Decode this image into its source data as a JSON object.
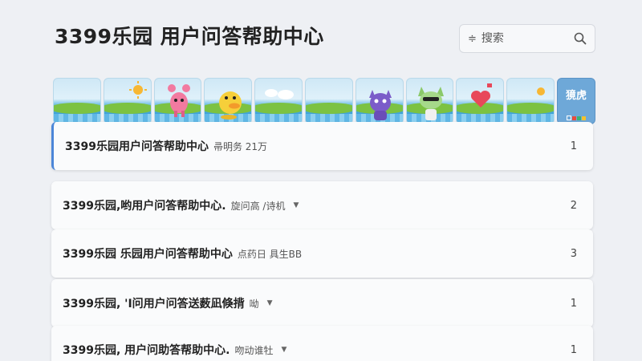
{
  "header": {
    "title": "3399乐园 用户问答帮助中心",
    "search_placeholder": "搜索"
  },
  "banner": {
    "tile_icons": [
      "landscape",
      "sun-icon",
      "pink-creature-icon",
      "yellow-duck-icon",
      "clouds-icon",
      "landscape",
      "purple-cat-icon",
      "green-cat-icon",
      "heart-icon",
      "sun-icon"
    ],
    "label": "獍虎"
  },
  "rows": [
    {
      "title": "3399乐园用户问答帮助中心",
      "meta": "帚明务 21万",
      "has_caret": false,
      "number": "1",
      "active": true
    },
    {
      "title": "3399乐园,哟用户问答帮助中心.",
      "meta": "旋问高 /诗机",
      "has_caret": true,
      "number": "2",
      "active": false
    },
    {
      "title": "3399乐园 乐园用户问答帮助中心",
      "meta": "点药日 具生BB",
      "has_caret": false,
      "number": "3",
      "active": false
    },
    {
      "title": "3399乐园, 'I问用户问答送薮凪倏揹",
      "meta": "呦",
      "has_caret": true,
      "number": "1",
      "active": false
    },
    {
      "title": "3399乐园, 用户问助答帮助中心.",
      "meta": "吻动谁牡",
      "has_caret": true,
      "number": "1",
      "active": false
    }
  ],
  "colors": {
    "background": "#eef0f4",
    "accent": "#4c86d8",
    "label_tile": "#6ea8d8"
  }
}
